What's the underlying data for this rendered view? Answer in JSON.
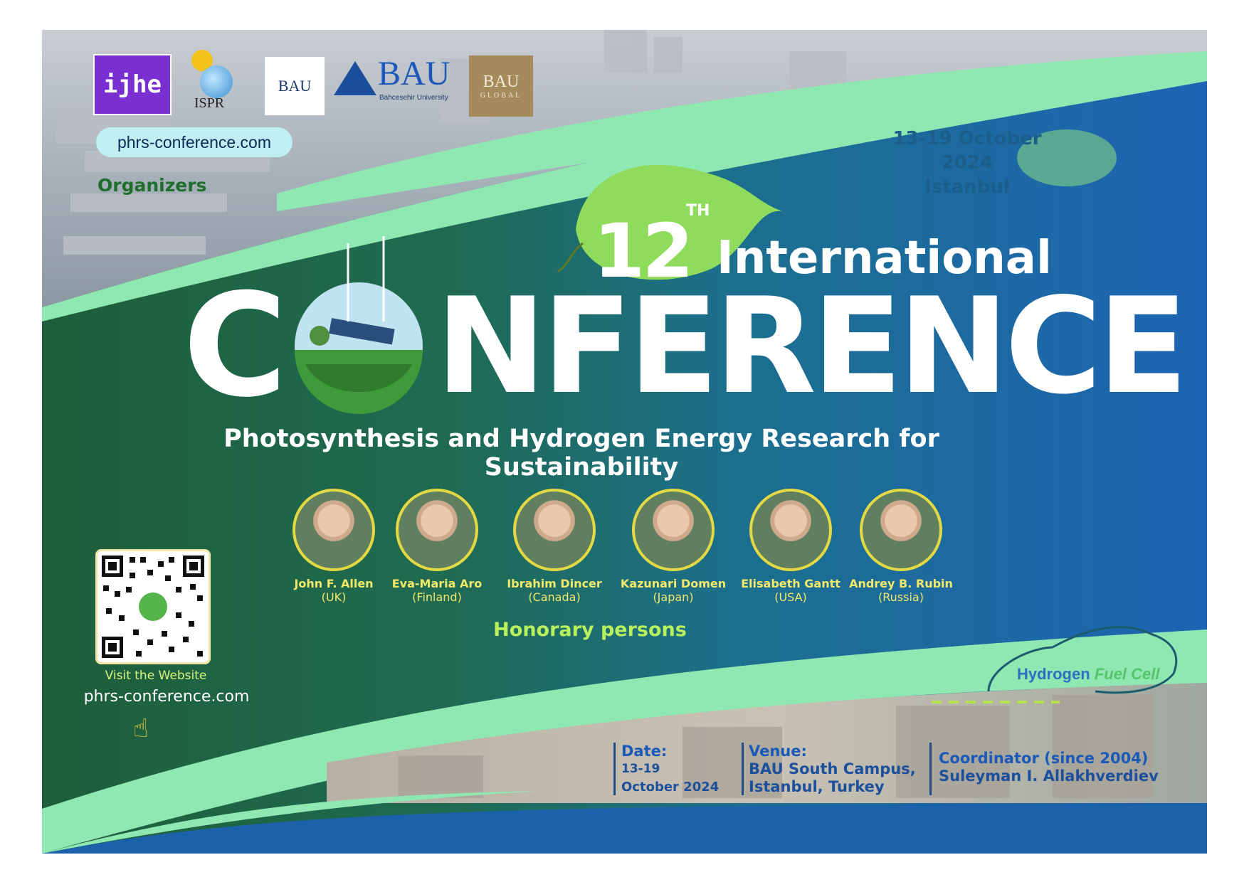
{
  "organizers": {
    "logos": [
      "ijhe",
      "ISPR",
      "BAU",
      "BAU",
      "BAU"
    ],
    "ispr_label": "ISPR",
    "bau_label": "BAU",
    "bau_big_label": "BAU",
    "bau_university_caption": "Bahcesehir University",
    "bau_global_label": "BAU",
    "bau_global_caption": "GLOBAL",
    "website_pill": "phrs-conference.com",
    "heading": "Organizers"
  },
  "event": {
    "date_line1": "13-19 October",
    "date_line2": "2024",
    "city": "Istanbul",
    "edition_number": "12",
    "edition_suffix": "TH",
    "title_word": "International",
    "conference_first": "C",
    "conference_rest": "NFERENCE",
    "subtitle": "Photosynthesis and Hydrogen Energy Research for Sustainability"
  },
  "honorary": {
    "heading": "Honorary persons",
    "persons": [
      {
        "name": "John F. Allen",
        "country": "(UK)"
      },
      {
        "name": "Eva-Maria Aro",
        "country": "(Finland)"
      },
      {
        "name": "Ibrahim Dincer",
        "country": "(Canada)"
      },
      {
        "name": "Kazunari Domen",
        "country": "(Japan)"
      },
      {
        "name": "Elisabeth Gantt",
        "country": "(USA)"
      },
      {
        "name": "Andrey B. Rubin",
        "country": "(Russia)"
      }
    ]
  },
  "website_block": {
    "visit_label": "Visit the Website",
    "url": "phrs-conference.com",
    "pointer_icon": "hand-pointer-icon"
  },
  "hydrogen": {
    "word1": "Hydrogen",
    "word2": "Fuel Cell"
  },
  "footer": {
    "date_label": "Date:",
    "date_line1": "13-19",
    "date_line2": "October 2024",
    "venue_label": "Venue:",
    "venue_line1": "BAU South Campus,",
    "venue_line2": "Istanbul, Turkey",
    "coordinator_label": "Coordinator (since 2004)",
    "coordinator_name": "Suleyman I. Allakhverdiev"
  },
  "colors": {
    "mint": "#8fe8b2",
    "dark_green": "#1e5e3a",
    "blue": "#1d64b4",
    "yellow_text": "#f2e86a"
  }
}
